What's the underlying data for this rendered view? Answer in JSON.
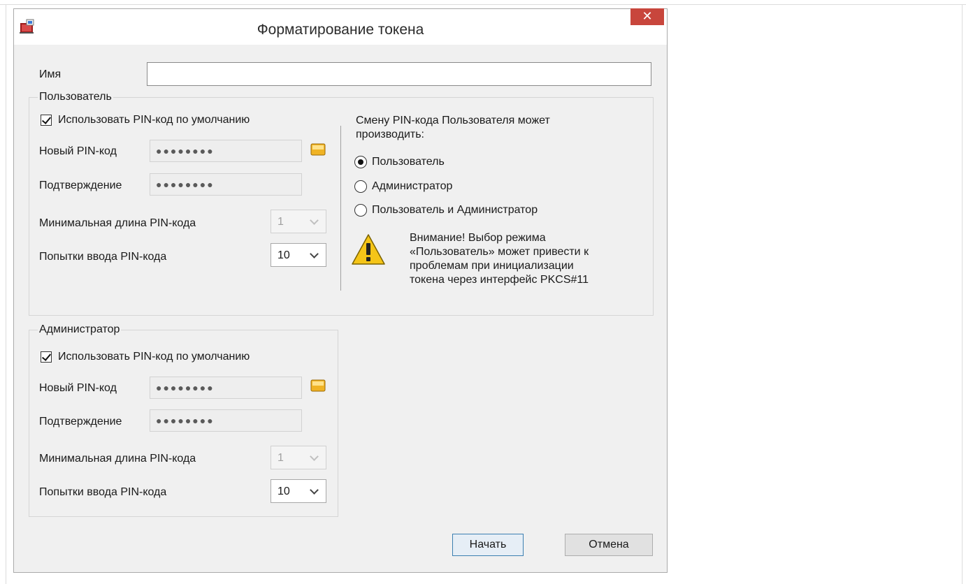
{
  "window": {
    "title": "Форматирование токена",
    "close_label": "✕"
  },
  "name": {
    "label": "Имя",
    "value": ""
  },
  "user": {
    "group_title": "Пользователь",
    "use_default_pin_label": "Использовать PIN-код по умолчанию",
    "use_default_pin_checked": true,
    "new_pin_label": "Новый PIN-код",
    "new_pin_value": "●●●●●●●●",
    "confirm_label": "Подтверждение",
    "confirm_value": "●●●●●●●●",
    "min_length_label": "Минимальная длина PIN-кода",
    "min_length_value": "1",
    "attempts_label": "Попытки ввода PIN-кода",
    "attempts_value": "10"
  },
  "change_pin": {
    "heading": "Смену PIN-кода Пользователя может\nпроизводить:",
    "options": [
      {
        "label": "Пользователь",
        "selected": true
      },
      {
        "label": "Администратор",
        "selected": false
      },
      {
        "label": "Пользователь и Администратор",
        "selected": false
      }
    ],
    "warning": "Внимание! Выбор режима\n«Пользователь» может привести к\nпроблемам при инициализации\nтокена через интерфейс PKCS#11"
  },
  "admin": {
    "group_title": "Администратор",
    "use_default_pin_label": "Использовать PIN-код по умолчанию",
    "use_default_pin_checked": true,
    "new_pin_label": "Новый PIN-код",
    "new_pin_value": "●●●●●●●●",
    "confirm_label": "Подтверждение",
    "confirm_value": "●●●●●●●●",
    "min_length_label": "Минимальная длина PIN-кода",
    "min_length_value": "1",
    "attempts_label": "Попытки ввода PIN-кода",
    "attempts_value": "10"
  },
  "buttons": {
    "start": "Начать",
    "cancel": "Отмена"
  },
  "colors": {
    "close_button": "#c8463c",
    "dialog_bg": "#f0f0f0",
    "default_button_border": "#3c7fb1"
  },
  "icons": {
    "app": "token-app-icon",
    "key": "pin-generate-icon",
    "warning": "warning-icon"
  }
}
